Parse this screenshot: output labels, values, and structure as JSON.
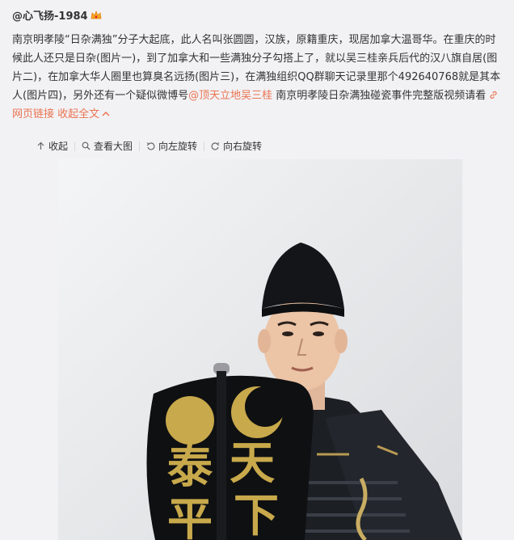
{
  "author": {
    "name": "@心飞扬-1984",
    "badge_icon": "vip-crown-icon",
    "badge_color": "#f5a623"
  },
  "post": {
    "text_main": "南京明孝陵“日杂满独”分子大起底，此人名叫张圆圆，汉族，原籍重庆，现居加拿大温哥华。在重庆的时候此人还只是日杂(图片一)，到了加拿大和一些满独分子勾搭上了，就以吴三桂亲兵后代的汉八旗自居(图片二)，在加拿大华人圈里也算臭名远扬(图片三)，在满独组织QQ群聊天记录里那个492640768就是其本人(图片四)，另外还有一个疑似微博号",
    "mention": "@顶天立地吴三桂",
    "text_after_mention": " 南京明孝陵日杂满独碰瓷事件完整版视频请看",
    "link_icon": "link-icon",
    "link_text": "网页链接",
    "collapse_text": "收起全文",
    "collapse_icon": "chevron-up-icon",
    "link_color": "#eb7350"
  },
  "toolbar": {
    "collapse_label": "收起",
    "collapse_icon": "arrow-up-icon",
    "view_large_label": "查看大图",
    "view_large_icon": "magnifier-icon",
    "rotate_left_label": "向左旋转",
    "rotate_left_icon": "rotate-left-icon",
    "rotate_right_label": "向右旋转",
    "rotate_right_icon": "rotate-right-icon"
  },
  "photo": {
    "shield_chars": [
      "天",
      "下",
      "泰",
      "平"
    ]
  }
}
